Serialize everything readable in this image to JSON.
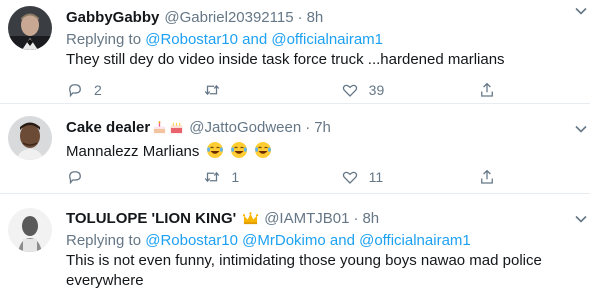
{
  "tweets": [
    {
      "name": "GabbyGabby",
      "handle": "@Gabriel20392115",
      "dot": "·",
      "time": "8h",
      "replying_prefix": "Replying to",
      "replying_links": "@Robostar10 and @officialnairam1",
      "text": "They still dey do video inside task force truck ...hardened marlians",
      "reply_count": "2",
      "retweet_count": "",
      "like_count": "39"
    },
    {
      "name": "Cake dealer",
      "handle": "@JattoGodween",
      "dot": "·",
      "time": "7h",
      "text": "Mannalezz Marlians",
      "reply_count": "",
      "retweet_count": "1",
      "like_count": "11"
    },
    {
      "name": "TOLULOPE 'LION KING'",
      "handle": "@IAMTJB01",
      "dot": "·",
      "time": "8h",
      "replying_prefix": "Replying to",
      "replying_links": "@Robostar10 @MrDokimo and @officialnairam1",
      "text": "This is not even funny, intimidating those young boys nawao mad police everywhere"
    }
  ],
  "icons": {
    "reply": "reply-icon",
    "retweet": "retweet-icon",
    "like": "heart-icon",
    "share": "share-icon",
    "menu": "chevron-down-icon"
  },
  "colors": {
    "link": "#1da1f2",
    "muted": "#657786",
    "text": "#14171a",
    "divider": "#e6ecf0"
  }
}
